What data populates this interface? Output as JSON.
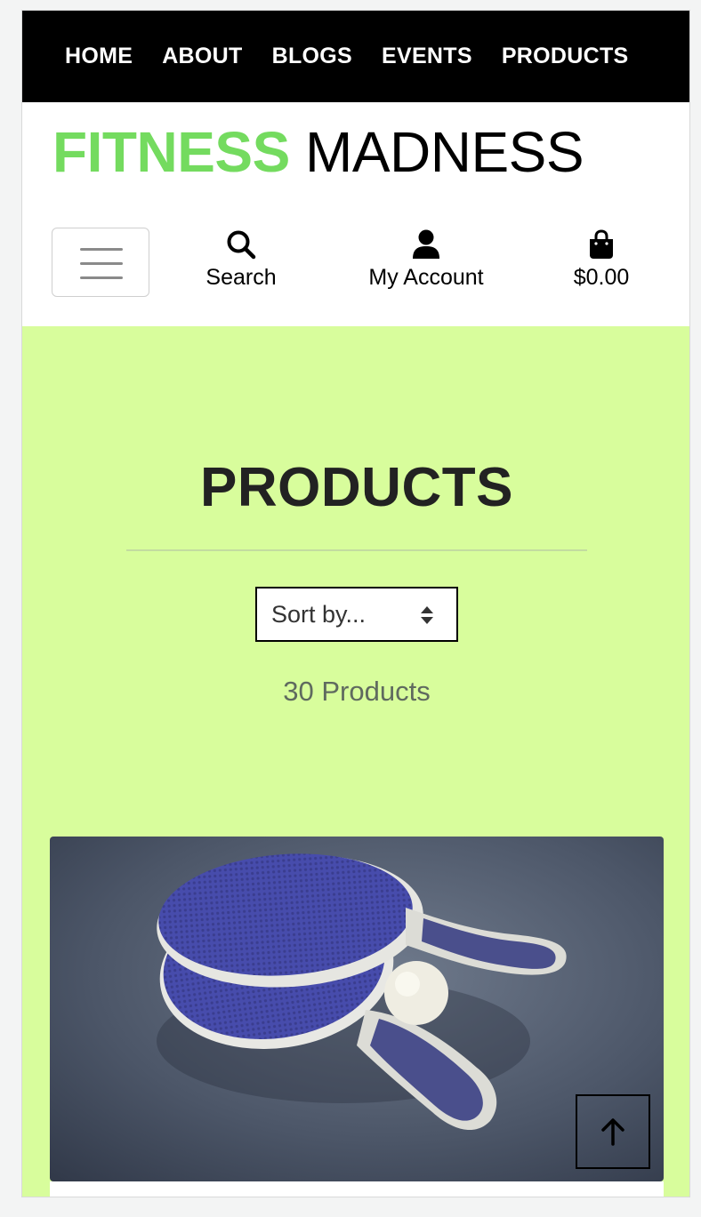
{
  "nav": {
    "items": [
      {
        "label": "HOME"
      },
      {
        "label": "ABOUT"
      },
      {
        "label": "BLOGS"
      },
      {
        "label": "EVENTS"
      },
      {
        "label": "PRODUCTS"
      }
    ]
  },
  "brand": {
    "part1": "FITNESS",
    "part2": "MADNESS",
    "accent_color": "#74db5f"
  },
  "toolbar": {
    "menu_icon": "hamburger-icon",
    "search": {
      "label": "Search",
      "icon": "search-icon"
    },
    "account": {
      "label": "My Account",
      "icon": "user-icon"
    },
    "cart": {
      "label": "$0.00",
      "icon": "shopping-bag-icon"
    }
  },
  "page": {
    "title": "PRODUCTS",
    "background": "#d8fd9c",
    "sort": {
      "selected": "Sort by..."
    },
    "count": "30 Products"
  },
  "products": [
    {
      "image": "table-tennis-paddles-photo"
    }
  ],
  "back_to_top": {
    "icon": "arrow-up-icon"
  }
}
